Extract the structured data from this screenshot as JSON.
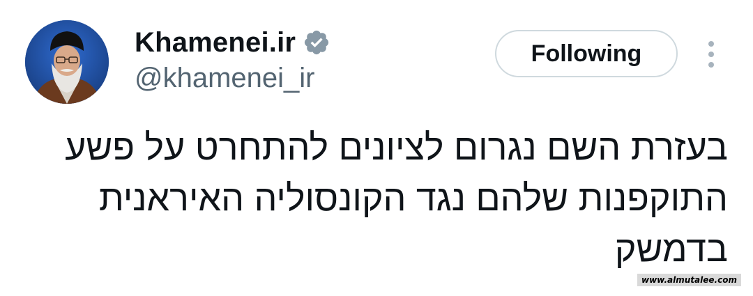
{
  "profile": {
    "display_name": "Khamenei.ir",
    "handle": "@khamenei_ir",
    "verified_icon": "verified-badge-icon",
    "verified_color": "#8899a6",
    "avatar_icon": "profile-photo"
  },
  "actions": {
    "follow_label": "Following",
    "more_icon": "more-vertical-icon"
  },
  "tweet": {
    "lines": [
      "בעזרת השם נגרום לציונים להתחרט על פשע",
      "התוקפנות שלהם נגד הקונסוליה האיראנית",
      "בדמשק"
    ]
  },
  "watermark": {
    "text": "www.almutalee.com"
  },
  "colors": {
    "text": "#0f1419",
    "secondary_text": "#536471",
    "button_border": "#cfd9de"
  }
}
